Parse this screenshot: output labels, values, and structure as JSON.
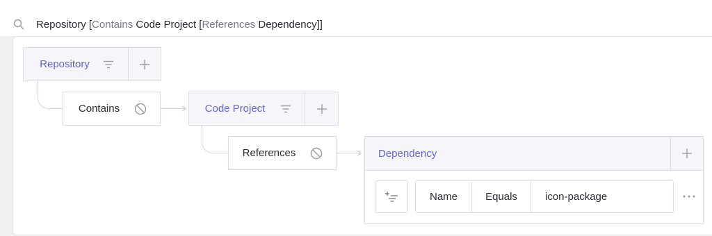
{
  "search": {
    "query_parts": [
      {
        "text": "Repository ",
        "kind": "entity"
      },
      {
        "text": "[",
        "kind": "bracket"
      },
      {
        "text": "Contains",
        "kind": "keyword"
      },
      {
        "text": " Code Project ",
        "kind": "entity"
      },
      {
        "text": "[",
        "kind": "bracket"
      },
      {
        "text": "References",
        "kind": "keyword"
      },
      {
        "text": " Dependency",
        "kind": "entity"
      },
      {
        "text": "]]",
        "kind": "bracket"
      }
    ]
  },
  "graph": {
    "repository": {
      "label": "Repository"
    },
    "contains": {
      "label": "Contains"
    },
    "code_project": {
      "label": "Code Project"
    },
    "references": {
      "label": "References"
    },
    "dependency": {
      "label": "Dependency"
    }
  },
  "filter": {
    "field": "Name",
    "operator": "Equals",
    "value": "icon-package"
  },
  "colors": {
    "entity_text": "#6366d8",
    "entity_bg": "#f5f5fa",
    "border": "#dcdce3",
    "icon": "#9a9aa6"
  },
  "icons": [
    "search-icon",
    "filter-icon",
    "add-icon",
    "no-entry-icon",
    "add-filter-icon",
    "more-icon"
  ]
}
